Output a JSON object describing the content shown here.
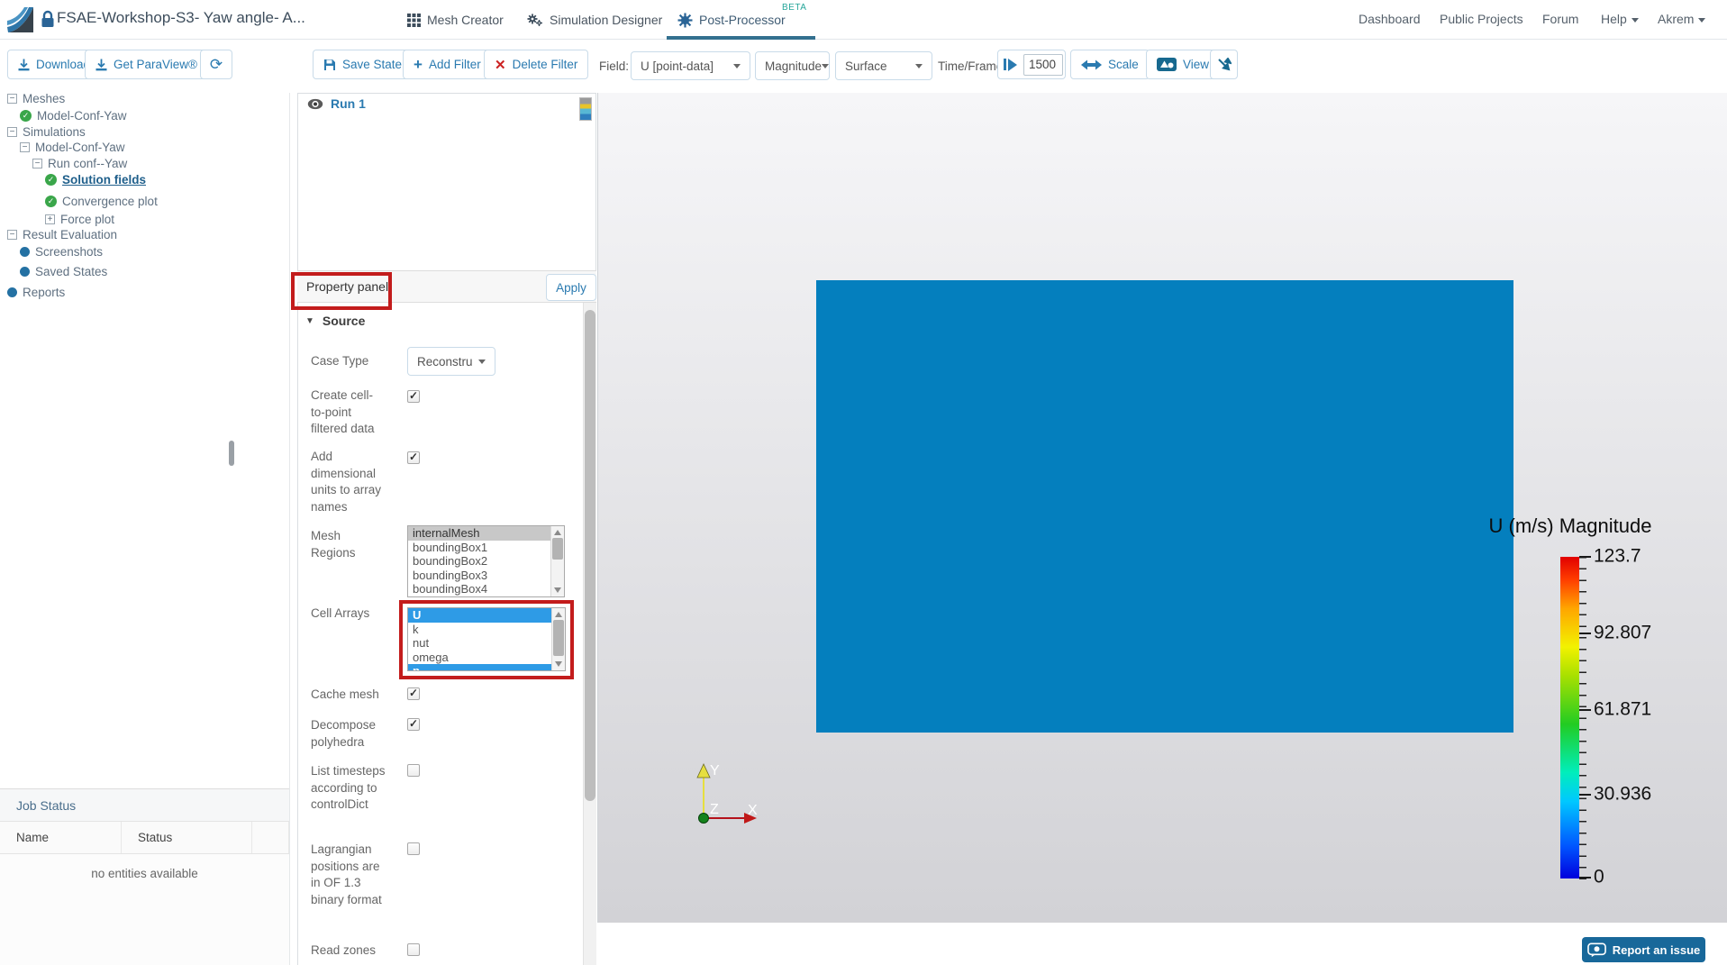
{
  "colors": {
    "accent_blue": "#2a7ab0",
    "annotation_red": "#c31c1c",
    "surface_blue": "#047fbe",
    "report_button_blue": "#18689a",
    "tab_underline": "#33708f",
    "beta_teal": "#26a69a",
    "selection_blue": "#2e9be6",
    "check_green": "#3aa64a"
  },
  "header": {
    "project_title": "FSAE-Workshop-S3- Yaw angle- A...",
    "tabs": [
      {
        "label": "Mesh Creator",
        "active": false
      },
      {
        "label": "Simulation Designer",
        "active": false
      },
      {
        "label": "Post-Processor",
        "badge": "BETA",
        "active": true
      }
    ],
    "nav": [
      {
        "label": "Dashboard"
      },
      {
        "label": "Public Projects"
      },
      {
        "label": "Forum"
      },
      {
        "label": "Help",
        "dropdown": true
      },
      {
        "label": "Akrem",
        "dropdown": true
      }
    ]
  },
  "sidebar": {
    "download_label": "Download",
    "get_paraview_label": "Get ParaView®",
    "tree": [
      {
        "label": "Meshes",
        "icon": "collapse"
      },
      {
        "label": "Model-Conf-Yaw",
        "icon": "check"
      },
      {
        "label": "Simulations",
        "icon": "collapse"
      },
      {
        "label": "Model-Conf-Yaw",
        "icon": "collapse"
      },
      {
        "label": "Run conf--Yaw",
        "icon": "collapse"
      },
      {
        "label": "Solution fields",
        "icon": "check",
        "selected": true
      },
      {
        "label": "Convergence plot",
        "icon": "check"
      },
      {
        "label": "Force plot",
        "icon": "expand"
      },
      {
        "label": "Result Evaluation",
        "icon": "collapse"
      },
      {
        "label": "Screenshots",
        "icon": "dot"
      },
      {
        "label": "Saved States",
        "icon": "dot"
      },
      {
        "label": "Reports",
        "icon": "dot"
      }
    ],
    "job_status": {
      "title": "Job Status",
      "columns": [
        {
          "label": "Name"
        },
        {
          "label": "Status"
        }
      ],
      "empty_text": "no entities available"
    }
  },
  "toolbar": {
    "save_state_label": "Save State",
    "add_filter_label": "Add Filter",
    "delete_filter_label": "Delete Filter",
    "field_label": "Field:",
    "field_value": "U [point-data]",
    "component_value": "Magnitude",
    "representation_value": "Surface",
    "time_frame_label": "Time/Frame:",
    "time_value": "1500",
    "scale_label": "Scale",
    "view_label": "View"
  },
  "pipeline": {
    "run_label": "Run 1"
  },
  "property_panel": {
    "title": "Property panel",
    "apply_label": "Apply",
    "source_section": "Source",
    "case_type": {
      "label": "Case Type",
      "value": "Reconstru"
    },
    "checkboxes": [
      {
        "label": "Create cell-to-point filtered data",
        "checked": true
      },
      {
        "label": "Add dimensional units to array names",
        "checked": true
      },
      {
        "label": "Cache mesh",
        "checked": true
      },
      {
        "label": "Decompose polyhedra",
        "checked": true
      },
      {
        "label": "List timesteps according to controlDict",
        "checked": false
      },
      {
        "label": "Lagrangian positions are in OF 1.3 binary format",
        "checked": false
      },
      {
        "label": "Read zones",
        "checked": false
      }
    ],
    "mesh_regions": {
      "label": "Mesh Regions",
      "options": [
        {
          "label": "internalMesh",
          "selected": true
        },
        {
          "label": "boundingBox1",
          "selected": false
        },
        {
          "label": "boundingBox2",
          "selected": false
        },
        {
          "label": "boundingBox3",
          "selected": false
        },
        {
          "label": "boundingBox4",
          "selected": false
        }
      ]
    },
    "cell_arrays": {
      "label": "Cell Arrays",
      "options": [
        {
          "label": "U",
          "selected": true
        },
        {
          "label": "k",
          "selected": false
        },
        {
          "label": "nut",
          "selected": false
        },
        {
          "label": "omega",
          "selected": false
        },
        {
          "label": "p",
          "selected": true
        }
      ]
    }
  },
  "viewport": {
    "legend": {
      "title": "U (m/s) Magnitude",
      "ticks": [
        "123.7",
        "92.807",
        "61.871",
        "30.936",
        "0"
      ],
      "colormap": "jet",
      "range": [
        0,
        123.7
      ]
    },
    "axes": {
      "x": "X",
      "y": "Y",
      "z": "Z"
    },
    "report_button_label": "Report an issue"
  }
}
